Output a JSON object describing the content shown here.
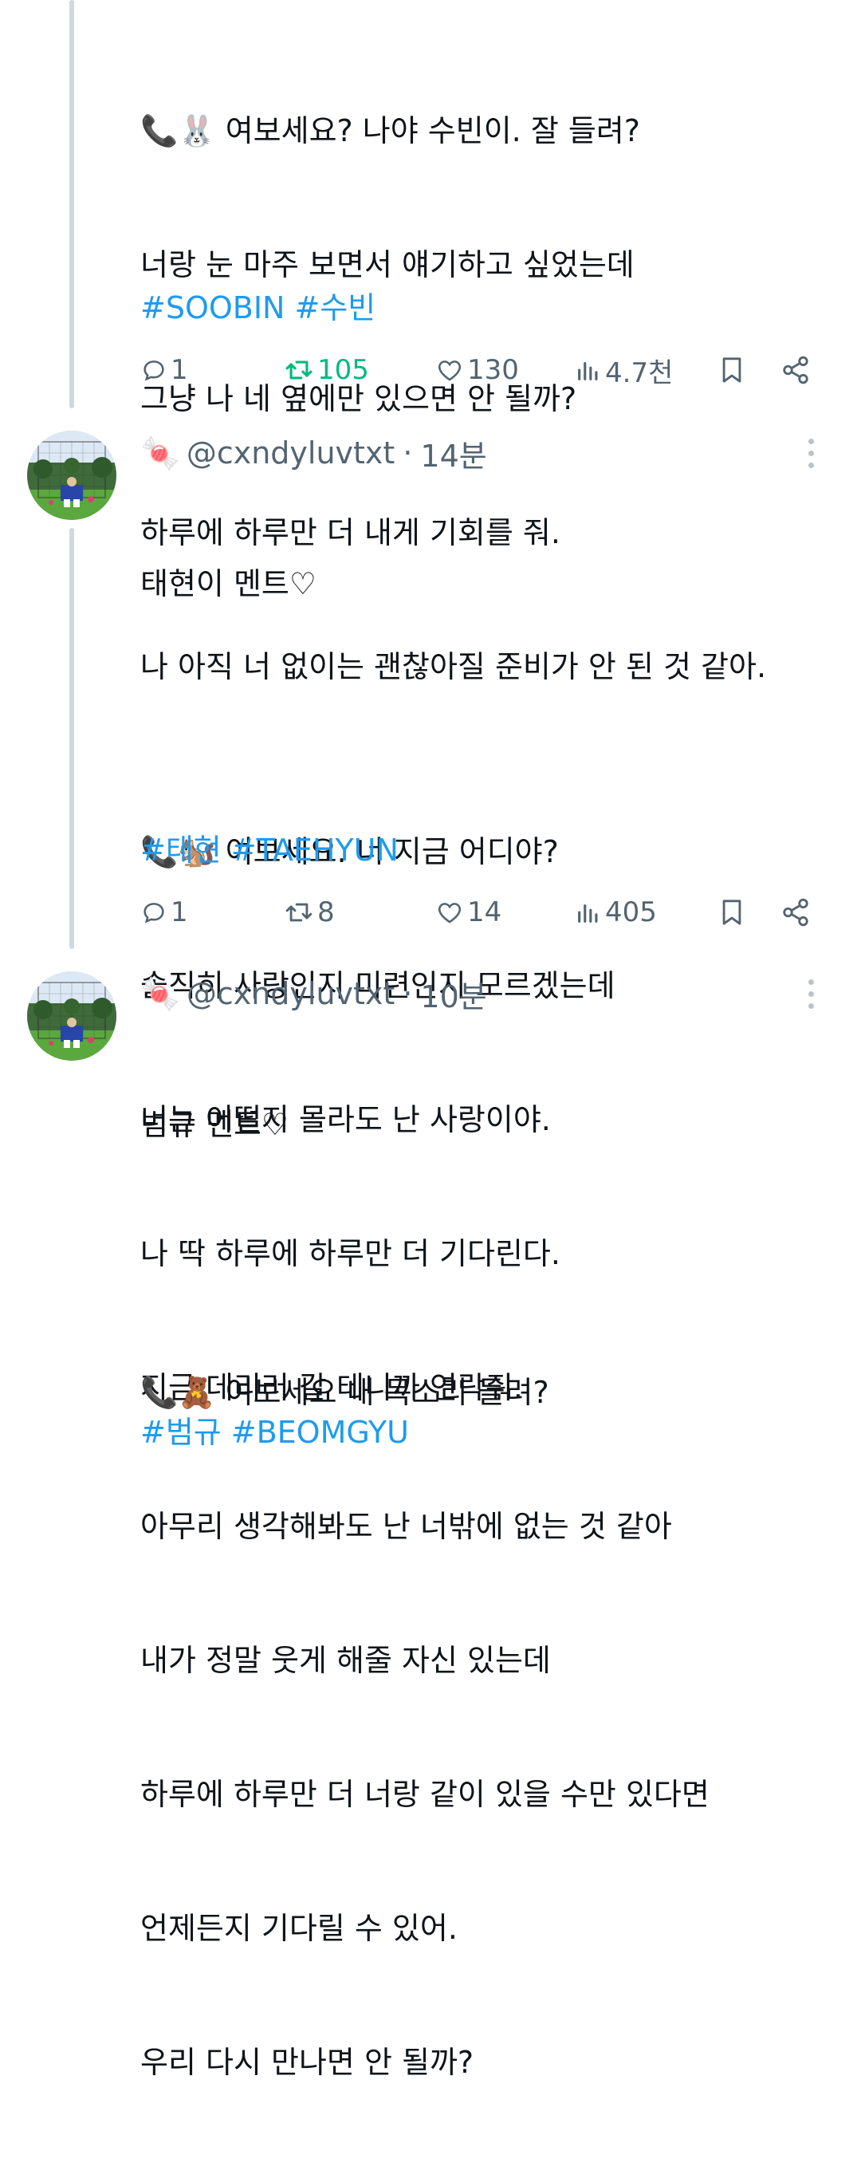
{
  "tweets": [
    {
      "header": null,
      "lines": [
        "📞🐰 여보세요? 나야 수빈이. 잘 들려?",
        "너랑 눈 마주 보면서 얘기하고 싶었는데",
        "그냥 나 네 옆에만 있으면 안 될까?",
        "하루에 하루만 더 내게 기회를 줘.",
        "나 아직 너 없이는 괜찮아질 준비가 안 된 것 같아."
      ],
      "hashtags": [
        "#SOOBIN",
        "#수빈"
      ],
      "replies": "1",
      "retweets": "105",
      "likes": "130",
      "views": "4.7천",
      "retweeted": true
    },
    {
      "header": {
        "emoji": "🍬",
        "handle": "@cxndyluvtxt",
        "dot": "·",
        "time": "14분"
      },
      "lines": [
        "태현이 멘트♡",
        "",
        "📞🐿️ 여보세요. 너 지금 어디야?",
        "솔직히 사랑인지 미련인지 모르겠는데",
        "너는 어떨지 몰라도 난 사랑이야.",
        "나 딱 하루에 하루만 더 기다린다.",
        "지금 데리러 갈 테니까 연락줘."
      ],
      "hashtags": [
        "#태현",
        "#TAEHYUN"
      ],
      "replies": "1",
      "retweets": "8",
      "likes": "14",
      "views": "405",
      "retweeted": false
    },
    {
      "header": {
        "emoji": "🍬",
        "handle": "@cxndyluvtxt",
        "dot": "·",
        "time": "10분"
      },
      "lines": [
        "범규 멘트♡",
        "",
        "📞🧸 여보세요 내 목소리 들려?",
        "아무리 생각해봐도 난 너밖에 없는 것 같아",
        "내가 정말 웃게 해줄 자신 있는데",
        "하루에 하루만 더 너랑 같이 있을 수만 있다면",
        "언제든지 기다릴 수 있어.",
        "우리 다시 만나면 안 될까?"
      ],
      "hashtags": [
        "#범규",
        "#BEOMGYU"
      ],
      "replies": null,
      "retweets": null,
      "likes": null,
      "views": null,
      "retweeted": false
    }
  ],
  "colors": {
    "text": "#0f1419",
    "secondary": "#536471",
    "link": "#1d9bf0",
    "retweet": "#00ba7c",
    "thread_line": "#cfd9de"
  },
  "icons": [
    "reply-icon",
    "retweet-icon",
    "like-icon",
    "views-icon",
    "bookmark-icon",
    "share-icon",
    "more-icon"
  ]
}
